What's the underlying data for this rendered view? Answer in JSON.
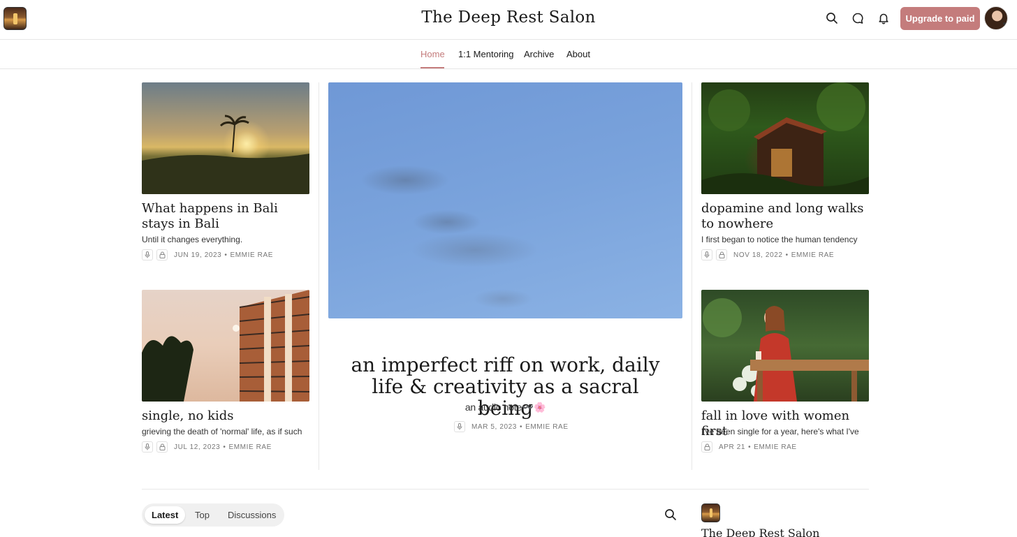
{
  "header": {
    "site_title": "The Deep Rest Salon",
    "upgrade_label": "Upgrade to paid",
    "icons": [
      "search-icon",
      "chat-icon",
      "bell-icon"
    ],
    "brand_color": "#c47c7c"
  },
  "nav": {
    "items": [
      {
        "label": "Home",
        "active": true
      },
      {
        "label": "1:1 Mentoring"
      },
      {
        "label": "Archive"
      },
      {
        "label": "About"
      }
    ]
  },
  "posts": {
    "bali": {
      "title": "What happens in Bali stays in Bali",
      "subtitle": "Until it changes everything.",
      "date": "JUN 19, 2023",
      "author": "EMMIE RAE"
    },
    "dopamine": {
      "title": "dopamine and long walks to nowhere",
      "subtitle": "I first began to notice the human tendency",
      "date": "NOV 18, 2022",
      "author": "EMMIE RAE"
    },
    "single": {
      "title": "single, no kids",
      "subtitle": "grieving the death of 'normal' life, as if such",
      "date": "JUL 12, 2023",
      "author": "EMMIE RAE"
    },
    "women": {
      "title": "fall in love with women first",
      "subtitle": "I've been single for a year, here's what I've",
      "date": "APR 21",
      "author": "EMMIE RAE"
    },
    "featured": {
      "title": "an imperfect riff on work, daily life & creativity as a sacral being",
      "subtitle": "an audio note〰️🌸",
      "date": "MAR 5, 2023",
      "author": "EMMIE RAE"
    }
  },
  "meta_separator": "•",
  "bottom": {
    "tabs": [
      {
        "label": "Latest",
        "active": true
      },
      {
        "label": "Top"
      },
      {
        "label": "Discussions"
      }
    ],
    "publication_name": "The Deep Rest Salon"
  }
}
